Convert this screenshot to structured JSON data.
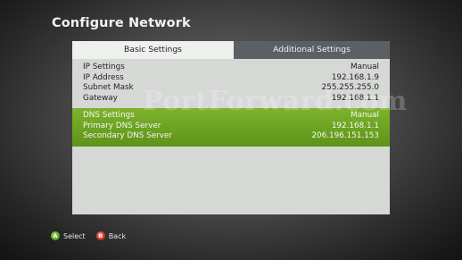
{
  "title": "Configure Network",
  "tabs": {
    "basic": "Basic Settings",
    "additional": "Additional Settings"
  },
  "ip_rows": [
    {
      "label": "IP Settings",
      "value": "Manual"
    },
    {
      "label": "IP Address",
      "value": "192.168.1.9"
    },
    {
      "label": "Subnet Mask",
      "value": "255.255.255.0"
    },
    {
      "label": "Gateway",
      "value": "192.168.1.1"
    }
  ],
  "dns_rows": [
    {
      "label": "DNS Settings",
      "value": "Manual"
    },
    {
      "label": "Primary DNS Server",
      "value": "192.168.1.1"
    },
    {
      "label": "Secondary DNS Server",
      "value": "206.196.151.153"
    }
  ],
  "watermark": "PortForward.com",
  "hints": {
    "a_glyph": "A",
    "a_label": "Select",
    "b_glyph": "B",
    "b_label": "Back"
  },
  "colors": {
    "selected_row": "#6ea424",
    "active_tab": "#eef0ee",
    "inactive_tab": "#5a6066",
    "button_a": "#4f9a1a",
    "button_b": "#c8221a"
  },
  "icons": {
    "a_button": "a-button-icon",
    "b_button": "b-button-icon"
  }
}
